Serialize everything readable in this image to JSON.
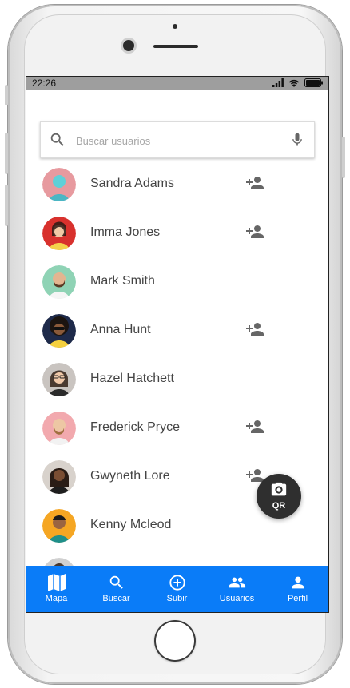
{
  "status_bar": {
    "time": "22:26",
    "icons": [
      "signal-icon",
      "wifi-icon",
      "battery-icon"
    ]
  },
  "search": {
    "placeholder": "Buscar usuarios",
    "value": "",
    "icon": "search-icon",
    "mic_icon": "mic-icon"
  },
  "users": [
    {
      "name": "Sandra Adams",
      "add_visible": true,
      "avatar_color": "#e79a9f"
    },
    {
      "name": "Imma Jones",
      "add_visible": true,
      "avatar_color": "#d8312d"
    },
    {
      "name": "Mark Smith",
      "add_visible": false,
      "avatar_color": "#8fd3b5"
    },
    {
      "name": "Anna Hunt",
      "add_visible": true,
      "avatar_color": "#1e2a4a"
    },
    {
      "name": "Hazel Hatchett",
      "add_visible": false,
      "avatar_color": "#c9c4c0"
    },
    {
      "name": "Frederick Pryce",
      "add_visible": true,
      "avatar_color": "#f2a9ae"
    },
    {
      "name": "Gwyneth Lore",
      "add_visible": true,
      "avatar_color": "#d8d2cc"
    },
    {
      "name": "Kenny Mcleod",
      "add_visible": false,
      "avatar_color": "#f5a623"
    }
  ],
  "fab": {
    "label": "QR",
    "icon": "camera-icon"
  },
  "bottom_nav": [
    {
      "label": "Mapa",
      "icon": "map-icon"
    },
    {
      "label": "Buscar",
      "icon": "search-icon"
    },
    {
      "label": "Subir",
      "icon": "add-circle-icon"
    },
    {
      "label": "Usuarios",
      "icon": "people-icon"
    },
    {
      "label": "Perfil",
      "icon": "person-icon"
    }
  ],
  "colors": {
    "accent": "#0a7cf8",
    "fab": "#2f2f2f",
    "status_bar": "#9e9e9e",
    "icon_gray": "#666666"
  }
}
